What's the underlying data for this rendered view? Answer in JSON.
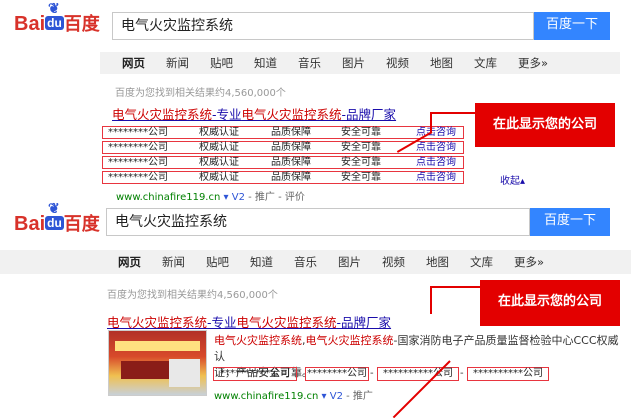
{
  "panel1": {
    "logo": {
      "bai": "Bai",
      "du": "du",
      "cn": "百度"
    },
    "query": "电气火灾监控系统",
    "search_button": "百度一下",
    "nav": [
      "网页",
      "新闻",
      "贴吧",
      "知道",
      "音乐",
      "图片",
      "视频",
      "地图",
      "文库",
      "更多»"
    ],
    "result_count": "百度为您找到相关结果约4,560,000个",
    "title_parts": [
      "电气火灾监控系统",
      "-专业",
      "电气火灾监控系统",
      "-品牌厂家"
    ],
    "rows": [
      {
        "company": "********公司",
        "f1": "权威认证",
        "f2": "品质保障",
        "f3": "安全可靠",
        "link": "点击咨询"
      },
      {
        "company": "********公司",
        "f1": "权威认证",
        "f2": "品质保障",
        "f3": "安全可靠",
        "link": "点击咨询"
      },
      {
        "company": "********公司",
        "f1": "权威认证",
        "f2": "品质保障",
        "f3": "安全可靠",
        "link": "点击咨询"
      },
      {
        "company": "********公司",
        "f1": "权威认证",
        "f2": "品质保障",
        "f3": "安全可靠",
        "link": "点击咨询"
      }
    ],
    "url": "www.chinafire119.cn",
    "v2": "V2",
    "promo": "推广",
    "review": "评价",
    "collapse": "收起",
    "badge": "在此显示您的公司"
  },
  "panel2": {
    "logo": {
      "bai": "Bai",
      "du": "du",
      "cn": "百度"
    },
    "query": "电气火灾监控系统",
    "search_button": "百度一下",
    "nav": [
      "网页",
      "新闻",
      "贴吧",
      "知道",
      "音乐",
      "图片",
      "视频",
      "地图",
      "文库",
      "更多»"
    ],
    "result_count": "百度为您找到相关结果约4,560,000个",
    "title_parts": [
      "电气火灾监控系统",
      "-专业",
      "电气火灾监控系统",
      "-品牌厂家"
    ],
    "desc_line1_hl": "电气火灾监控系统",
    "desc_line1_mid": ",",
    "desc_line1_hl2": "电气火灾监控系统",
    "desc_line1_rest": "-国家消防电子产品质量监督检验中心CCC权威认",
    "desc_line2": "证，产品安全可靠。",
    "companies": [
      "**********公司",
      "********公司",
      "**********公司",
      "**********公司"
    ],
    "url": "www.chinafire119.cn",
    "v2": "V2",
    "promo": "推广",
    "badge": "在此显示您的公司"
  }
}
